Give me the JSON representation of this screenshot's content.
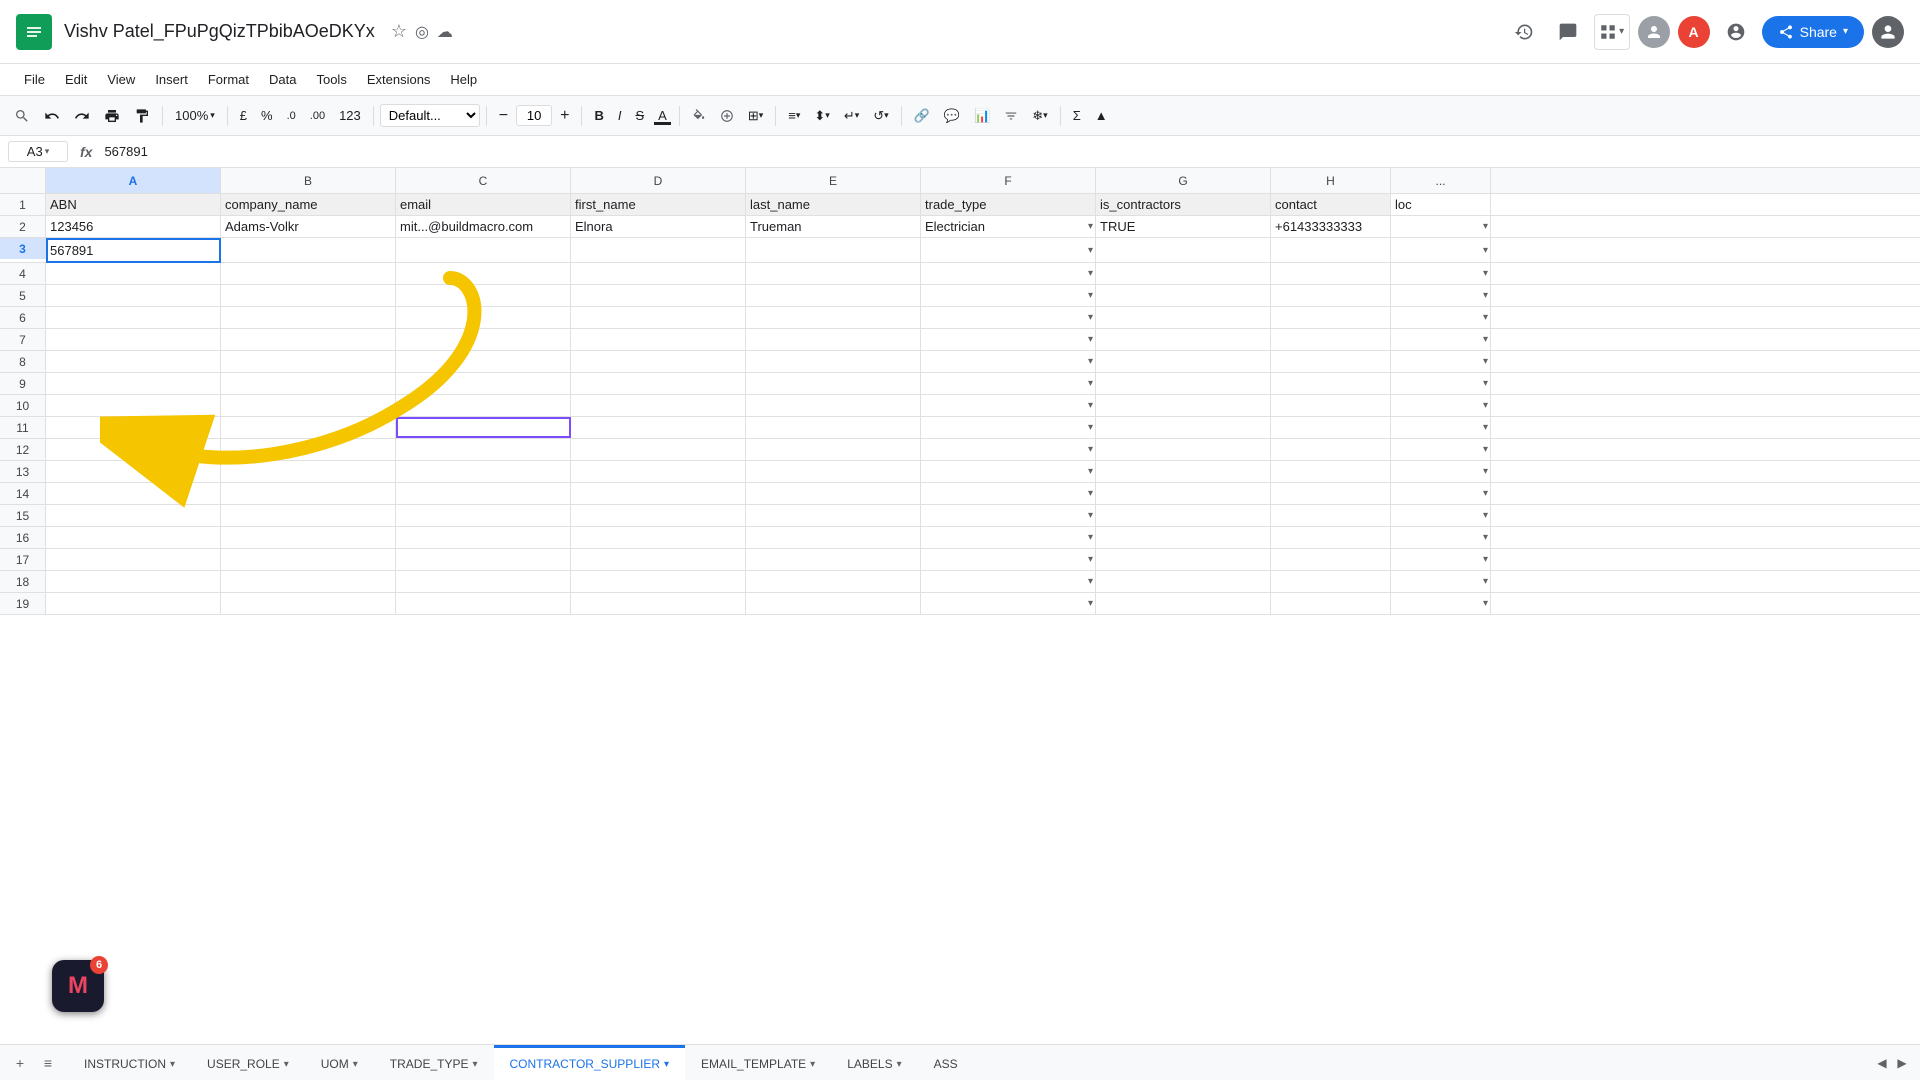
{
  "app": {
    "title": "Vishv Patel_FPuPgQizTPbibAOeDKYx",
    "logo": "≡",
    "menus": [
      "File",
      "Edit",
      "View",
      "Insert",
      "Format",
      "Data",
      "Tools",
      "Extensions",
      "Help"
    ]
  },
  "toolbar": {
    "zoom": "100%",
    "currency": "£",
    "percent": "%",
    "decimal_decrease": ".0",
    "decimal_increase": ".00",
    "format_number": "123",
    "font": "Default...",
    "font_size": "10",
    "bold": "B",
    "italic": "I",
    "strikethrough": "S"
  },
  "formula_bar": {
    "cell_ref": "A3",
    "formula": "567891"
  },
  "columns": {
    "headers": [
      "A",
      "B",
      "C",
      "D",
      "E",
      "F",
      "G",
      "H"
    ],
    "col_a_width": 175,
    "col_b_width": 175
  },
  "header_row": {
    "a": "ABN",
    "b": "company_name",
    "c": "email",
    "d": "first_name",
    "e": "last_name",
    "f": "trade_type",
    "g": "is_contractors",
    "h": "contact",
    "i": "loc"
  },
  "row2": {
    "a": "123456",
    "b": "Adams-Volkr",
    "c": "mit...@buildmacro.com",
    "d": "Elnora",
    "e": "Trueman",
    "f": "Electrician",
    "f_dropdown": true,
    "g": "TRUE",
    "h": "+61433333333"
  },
  "row3": {
    "a": "567891",
    "a_active": true
  },
  "row11": {
    "c_selected": true
  },
  "sheet_tabs": [
    {
      "id": "instruction",
      "label": "INSTRUCTION",
      "active": false
    },
    {
      "id": "user_role",
      "label": "USER_ROLE",
      "active": false
    },
    {
      "id": "uom",
      "label": "UOM",
      "active": false
    },
    {
      "id": "trade_type",
      "label": "TRADE_TYPE",
      "active": false
    },
    {
      "id": "contractor_supplier",
      "label": "CONTRACTOR_SUPPLIER",
      "active": true
    },
    {
      "id": "email_template",
      "label": "EMAIL_TEMPLATE",
      "active": false
    },
    {
      "id": "labels",
      "label": "LABELS",
      "active": false
    },
    {
      "id": "ass",
      "label": "ASS",
      "active": false
    }
  ],
  "avatars": [
    {
      "initials": "",
      "color": "#5f6368",
      "bg": "#9aa0a6"
    },
    {
      "initials": "A",
      "color": "#fff",
      "bg": "#ea4335"
    }
  ],
  "macro": {
    "badge": "6",
    "icon": "M"
  },
  "rows_visible": 18
}
